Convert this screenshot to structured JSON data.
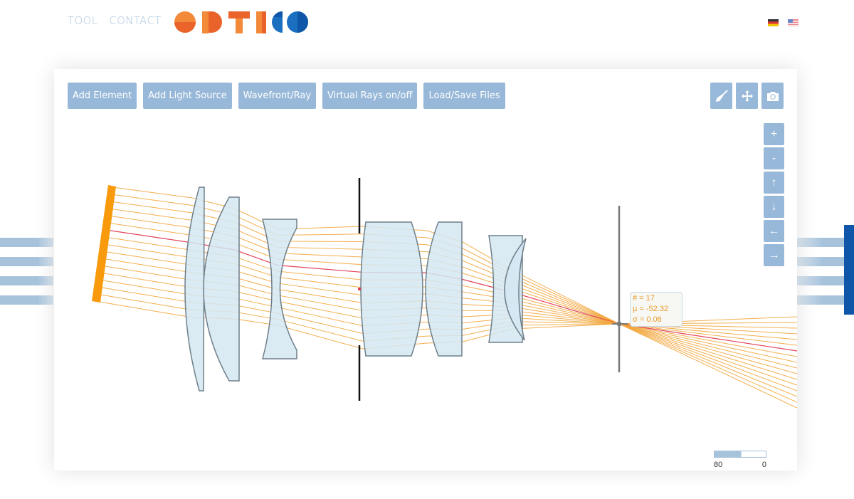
{
  "header": {
    "nav": [
      {
        "label": "TOOL"
      },
      {
        "label": "CONTACT"
      }
    ],
    "logo_text": "OPTICO",
    "languages": [
      {
        "code": "de",
        "icon": "german-flag-icon"
      },
      {
        "code": "en",
        "icon": "us-flag-icon"
      }
    ]
  },
  "toolbar": {
    "buttons": [
      {
        "label": "Add Element"
      },
      {
        "label": "Add Light Source"
      },
      {
        "label": "Wavefront/Ray"
      },
      {
        "label": "Virtual Rays on/off"
      },
      {
        "label": "Load/Save Files"
      }
    ],
    "tools": [
      {
        "name": "clear",
        "icon": "broom-icon"
      },
      {
        "name": "move",
        "icon": "move-arrows-icon"
      },
      {
        "name": "screenshot",
        "icon": "camera-icon"
      }
    ]
  },
  "view_controls": [
    {
      "name": "zoom-in",
      "label": "+"
    },
    {
      "name": "zoom-out",
      "label": "-"
    },
    {
      "name": "pan-up",
      "label": "↑"
    },
    {
      "name": "pan-down",
      "label": "↓"
    },
    {
      "name": "pan-left",
      "label": "←"
    },
    {
      "name": "pan-right",
      "label": "→"
    }
  ],
  "detector_stats": {
    "count": "# = 17",
    "mean": "μ = -52.32",
    "sigma": "σ = 0.06"
  },
  "scale": {
    "left": "80",
    "right": "0",
    "fill": 0.52
  },
  "colors": {
    "ray": "#f2a53a",
    "chief_ray": "#e0304a",
    "source": "#f89a0c",
    "lens_fill": "#d4e8f2",
    "lens_stroke": "#6e7f8a",
    "button": "#97b8d8",
    "accent_blue": "#0f56a8"
  }
}
